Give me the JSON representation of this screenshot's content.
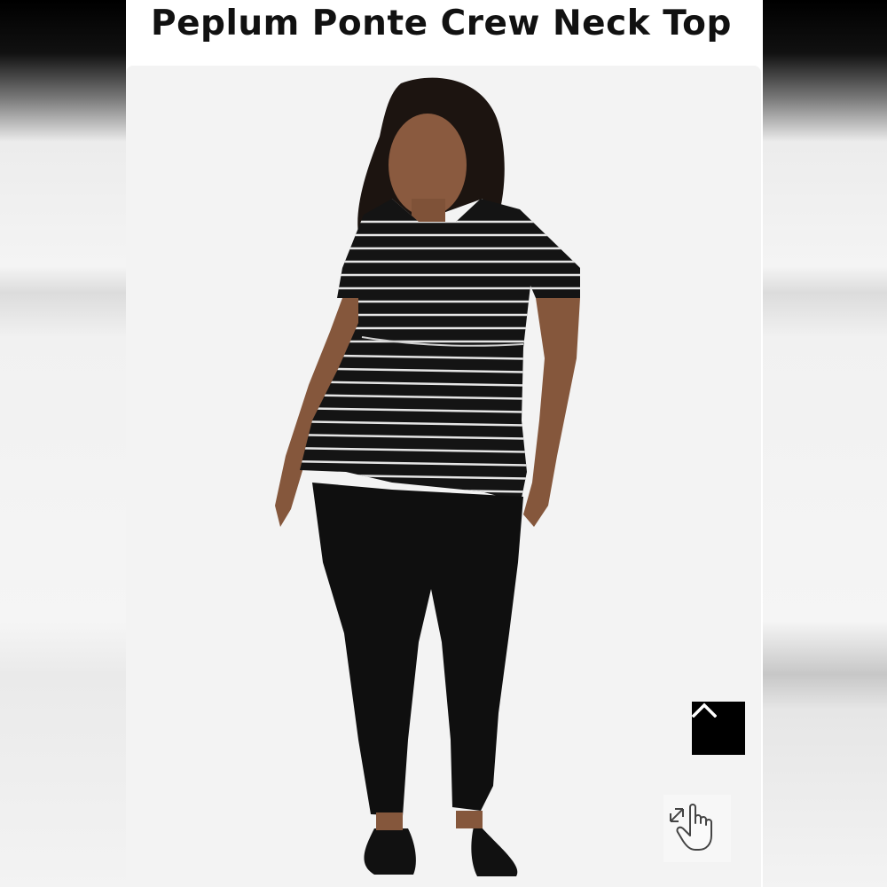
{
  "product": {
    "title": "Peplum Ponte Crew Neck Top"
  },
  "photo": {
    "alt": "Model wearing black and white striped peplum top with black leggings",
    "background_color": "#f3f3f3"
  },
  "controls": {
    "scroll_top_icon": "chevron-up-icon",
    "zoom_icon": "hand-pinch-zoom-icon"
  },
  "colors": {
    "title_text": "#111111",
    "scroll_button_bg": "#000000",
    "garment_black": "#141414",
    "stripe": "#e6e6e6"
  }
}
